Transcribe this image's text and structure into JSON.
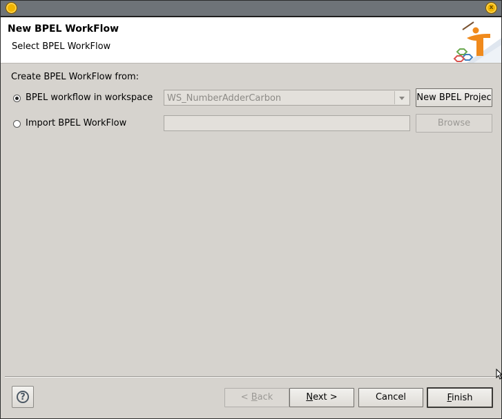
{
  "window": {
    "titlebar_left_icon": "menu-circle-icon",
    "titlebar_right_icon": "close-circle-icon",
    "close_glyph": "x"
  },
  "header": {
    "title": "New BPEL WorkFlow",
    "subtitle": "Select BPEL WorkFlow",
    "logo_icon": "wizard-logo-icon"
  },
  "form": {
    "group_label": "Create BPEL WorkFlow from:",
    "option_workspace": {
      "label": "BPEL workflow in workspace",
      "checked": true,
      "combo_value": "WS_NumberAdderCarbon",
      "button": "New BPEL Projec"
    },
    "option_import": {
      "label": "Import BPEL WorkFlow",
      "checked": false,
      "field_value": "",
      "button": "Browse"
    }
  },
  "footer": {
    "help_icon": "help-icon",
    "help_glyph": "?",
    "back": {
      "mnemonic": "B",
      "prefix": "< ",
      "rest": "ack"
    },
    "next": {
      "mnemonic": "N",
      "rest": "ext >"
    },
    "cancel": "Cancel",
    "finish": {
      "mnemonic": "F",
      "rest": "inish"
    }
  },
  "colors": {
    "dialog_bg": "#d6d3ce",
    "titlebar": "#6e7378",
    "header_bg": "#ffffff",
    "logo_orange": "#f08a1c",
    "logo_green": "#6aa84f",
    "logo_blue": "#3f7fbf",
    "disabled_text": "#9b9995"
  }
}
